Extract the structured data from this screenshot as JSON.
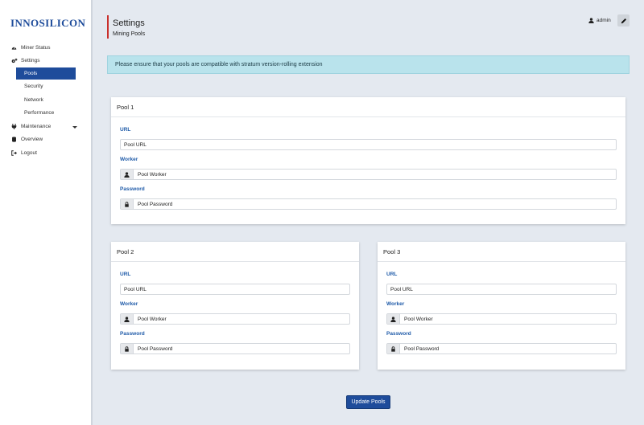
{
  "brand": {
    "logo_text": "INNOSILICON"
  },
  "sidebar": {
    "items": [
      {
        "label": "Miner Status",
        "icon": "dashboard-icon"
      },
      {
        "label": "Settings",
        "icon": "gears-icon"
      },
      {
        "label": "Pools",
        "icon": ""
      },
      {
        "label": "Security",
        "icon": ""
      },
      {
        "label": "Network",
        "icon": ""
      },
      {
        "label": "Performance",
        "icon": ""
      },
      {
        "label": "Maintenance",
        "icon": "plug-icon"
      },
      {
        "label": "Overview",
        "icon": "database-icon"
      },
      {
        "label": "Logout",
        "icon": "sign-out-icon"
      }
    ],
    "active": "Pools"
  },
  "header": {
    "title": "Settings",
    "subtitle": "Mining Pools",
    "user": "admin"
  },
  "alert": {
    "text": "Please ensure that your pools are compatible with stratum version-rolling extension"
  },
  "pools": [
    {
      "title": "Pool 1",
      "url_label": "URL",
      "url_placeholder": "Pool URL",
      "worker_label": "Worker",
      "worker_placeholder": "Pool Worker",
      "password_label": "Password",
      "password_placeholder": "Pool Password"
    },
    {
      "title": "Pool 2",
      "url_label": "URL",
      "url_placeholder": "Pool URL",
      "worker_label": "Worker",
      "worker_placeholder": "Pool Worker",
      "password_label": "Password",
      "password_placeholder": "Pool Password"
    },
    {
      "title": "Pool 3",
      "url_label": "URL",
      "url_placeholder": "Pool URL",
      "worker_label": "Worker",
      "worker_placeholder": "Pool Worker",
      "password_label": "Password",
      "password_placeholder": "Pool Password"
    }
  ],
  "actions": {
    "update_label": "Update Pools"
  },
  "colors": {
    "brand": "#1e4c9b",
    "accent_bar": "#c9302c",
    "alert_bg": "#b9e3ec",
    "label": "#1e5aa8",
    "page_bg": "#e4e9f0"
  }
}
